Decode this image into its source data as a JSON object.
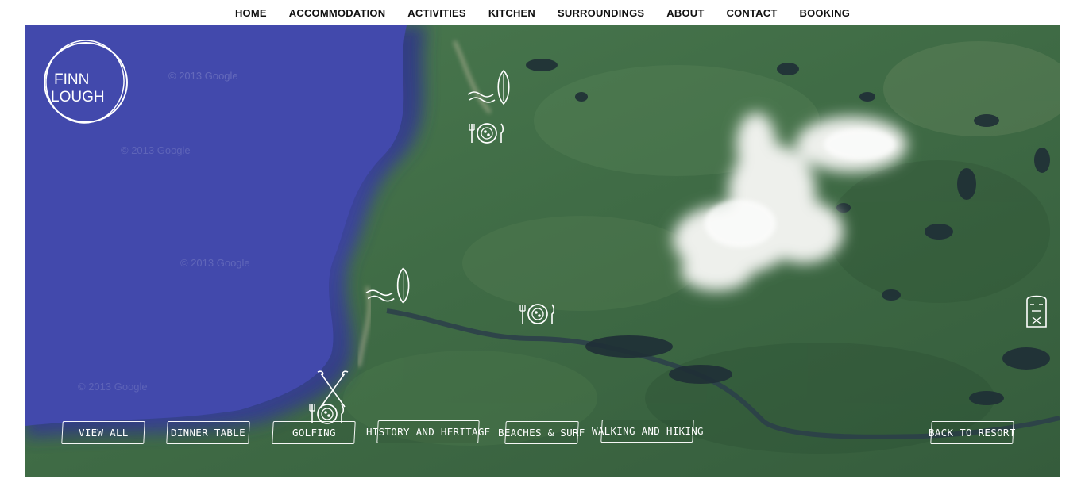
{
  "nav": {
    "items": [
      {
        "label": "HOME"
      },
      {
        "label": "ACCOMMODATION"
      },
      {
        "label": "ACTIVITIES"
      },
      {
        "label": "KITCHEN"
      },
      {
        "label": "SURROUNDINGS"
      },
      {
        "label": "ABOUT"
      },
      {
        "label": "CONTACT"
      },
      {
        "label": "BOOKING"
      }
    ]
  },
  "logo": {
    "line1": "FINN",
    "line2": "LOUGH"
  },
  "map": {
    "markers": [
      {
        "icon": "surfboard-waves-icon"
      },
      {
        "icon": "dinner-plate-icon"
      },
      {
        "icon": "surfboard-waves-icon"
      },
      {
        "icon": "dinner-plate-icon"
      },
      {
        "icon": "golf-clubs-icon"
      },
      {
        "icon": "dinner-plate-icon"
      },
      {
        "icon": "heritage-statue-icon"
      }
    ],
    "watermarks": [
      "© 2013 Google",
      "© 2013 Google",
      "© 2013 Google",
      "© 2013 Google"
    ]
  },
  "filters": {
    "view_all": "View All",
    "dinner_table": "Dinner Table",
    "golfing": "Golfing",
    "history": "History and Heritage",
    "beaches": "Beaches & Surf",
    "walking": "Walking and Hiking",
    "back": "Back to Resort"
  },
  "colors": {
    "sea": "#3f46a8",
    "land": "#3f6a45",
    "button_border": "#ffffff"
  }
}
